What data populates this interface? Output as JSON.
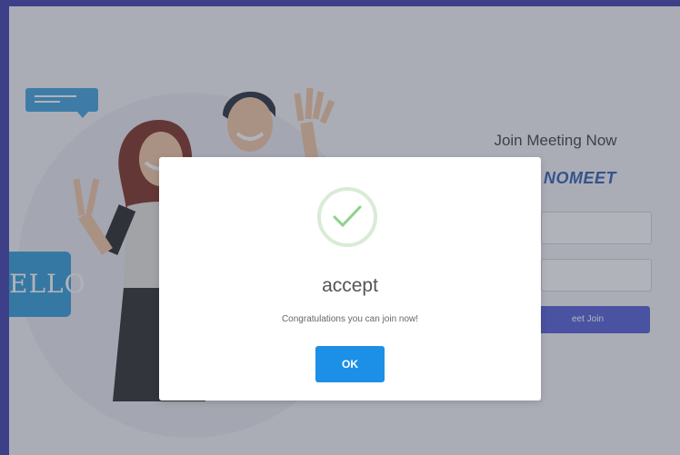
{
  "illustration": {
    "hello_text": "ELLO"
  },
  "login": {
    "title": "Join Meeting Now",
    "brand": "NOMEET",
    "meet_button_label": "eet Join"
  },
  "modal": {
    "icon": "checkmark-success-icon",
    "title": "accept",
    "message": "Congratulations you can join now!",
    "ok_label": "OK"
  },
  "colors": {
    "frame": "#3d4088",
    "accent": "#1c8fe6",
    "success": "#8fd18a",
    "meet_button": "#4f5bd5"
  }
}
